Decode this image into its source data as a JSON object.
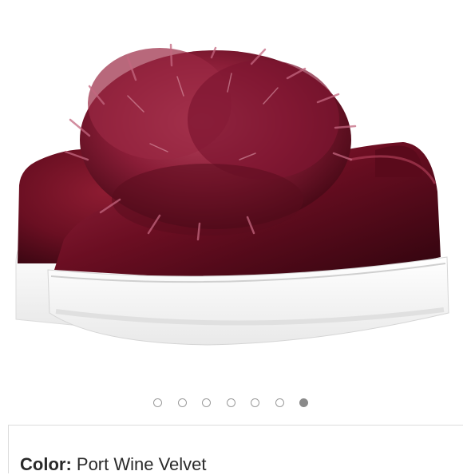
{
  "gallery": {
    "image_alt": "Port Wine Velvet pom-pom slip-on sneakers",
    "image_count": 7,
    "active_index": 6,
    "dot_color": "#9a9a9a",
    "active_dot_color": "#8a8a8a"
  },
  "details": {
    "color_label": "Color:",
    "color_value": "Port Wine Velvet"
  }
}
